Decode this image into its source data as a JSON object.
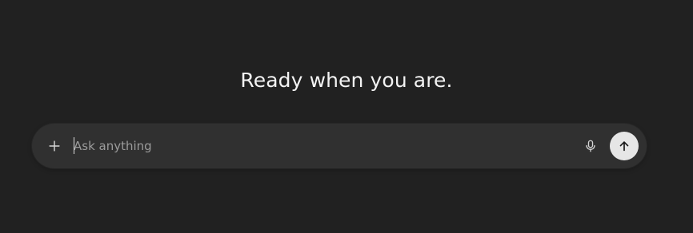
{
  "main": {
    "heading": "Ready when you are."
  },
  "composer": {
    "placeholder": "Ask anything",
    "value": "",
    "icons": {
      "attach": "plus-icon",
      "voice": "microphone-icon",
      "send": "arrow-up-icon"
    }
  },
  "colors": {
    "background": "#212121",
    "composer_background": "#303030",
    "send_button": "#e6e6e6",
    "text": "#ececec",
    "placeholder": "#9b9b9b"
  }
}
